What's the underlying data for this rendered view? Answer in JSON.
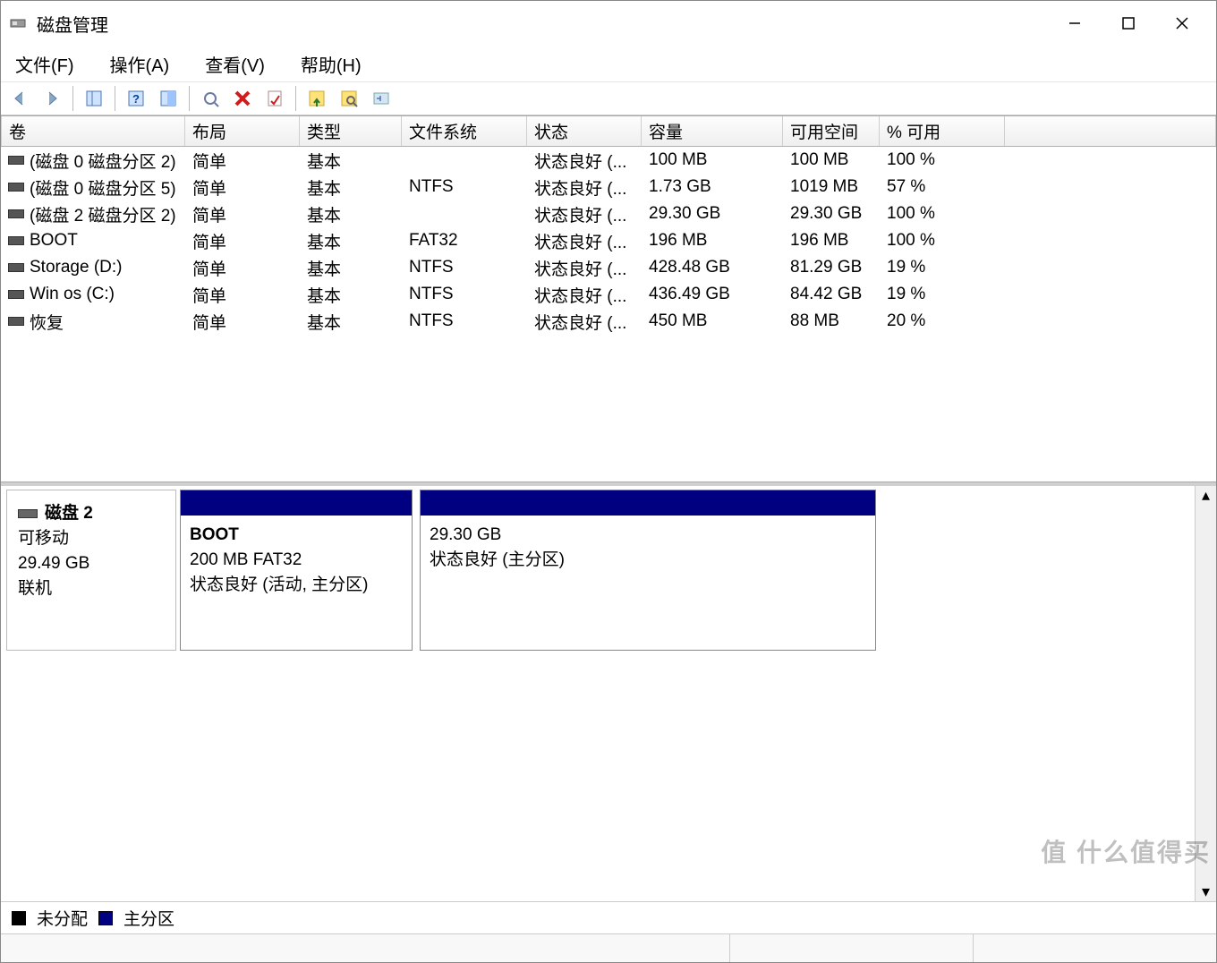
{
  "window": {
    "title": "磁盘管理"
  },
  "menu": {
    "file": "文件(F)",
    "action": "操作(A)",
    "view": "查看(V)",
    "help": "帮助(H)"
  },
  "columns": {
    "volume": "卷",
    "layout": "布局",
    "type": "类型",
    "fs": "文件系统",
    "status": "状态",
    "capacity": "容量",
    "free": "可用空间",
    "pctfree": "% 可用"
  },
  "volumes": [
    {
      "name": "(磁盘 0 磁盘分区 2)",
      "layout": "简单",
      "type": "基本",
      "fs": "",
      "status": "状态良好 (...",
      "capacity": "100 MB",
      "free": "100 MB",
      "pct": "100 %"
    },
    {
      "name": "(磁盘 0 磁盘分区 5)",
      "layout": "简单",
      "type": "基本",
      "fs": "NTFS",
      "status": "状态良好 (...",
      "capacity": "1.73 GB",
      "free": "1019 MB",
      "pct": "57 %"
    },
    {
      "name": "(磁盘 2 磁盘分区 2)",
      "layout": "简单",
      "type": "基本",
      "fs": "",
      "status": "状态良好 (...",
      "capacity": "29.30 GB",
      "free": "29.30 GB",
      "pct": "100 %"
    },
    {
      "name": "BOOT",
      "layout": "简单",
      "type": "基本",
      "fs": "FAT32",
      "status": "状态良好 (...",
      "capacity": "196 MB",
      "free": "196 MB",
      "pct": "100 %"
    },
    {
      "name": "Storage (D:)",
      "layout": "简单",
      "type": "基本",
      "fs": "NTFS",
      "status": "状态良好 (...",
      "capacity": "428.48 GB",
      "free": "81.29 GB",
      "pct": "19 %"
    },
    {
      "name": "Win os  (C:)",
      "layout": "简单",
      "type": "基本",
      "fs": "NTFS",
      "status": "状态良好 (...",
      "capacity": "436.49 GB",
      "free": "84.42 GB",
      "pct": "19 %"
    },
    {
      "name": "恢复",
      "layout": "简单",
      "type": "基本",
      "fs": "NTFS",
      "status": "状态良好 (...",
      "capacity": "450 MB",
      "free": "88 MB",
      "pct": "20 %"
    }
  ],
  "disk": {
    "name": "磁盘 2",
    "removable": "可移动",
    "size": "29.49 GB",
    "online": "联机",
    "partitions": [
      {
        "name": "BOOT",
        "meta": "200 MB FAT32",
        "status": "状态良好 (活动, 主分区)"
      },
      {
        "name": "",
        "meta": "29.30 GB",
        "status": "状态良好 (主分区)"
      }
    ]
  },
  "legend": {
    "unallocated": "未分配",
    "primary": "主分区"
  },
  "watermark": "值 什么值得买"
}
